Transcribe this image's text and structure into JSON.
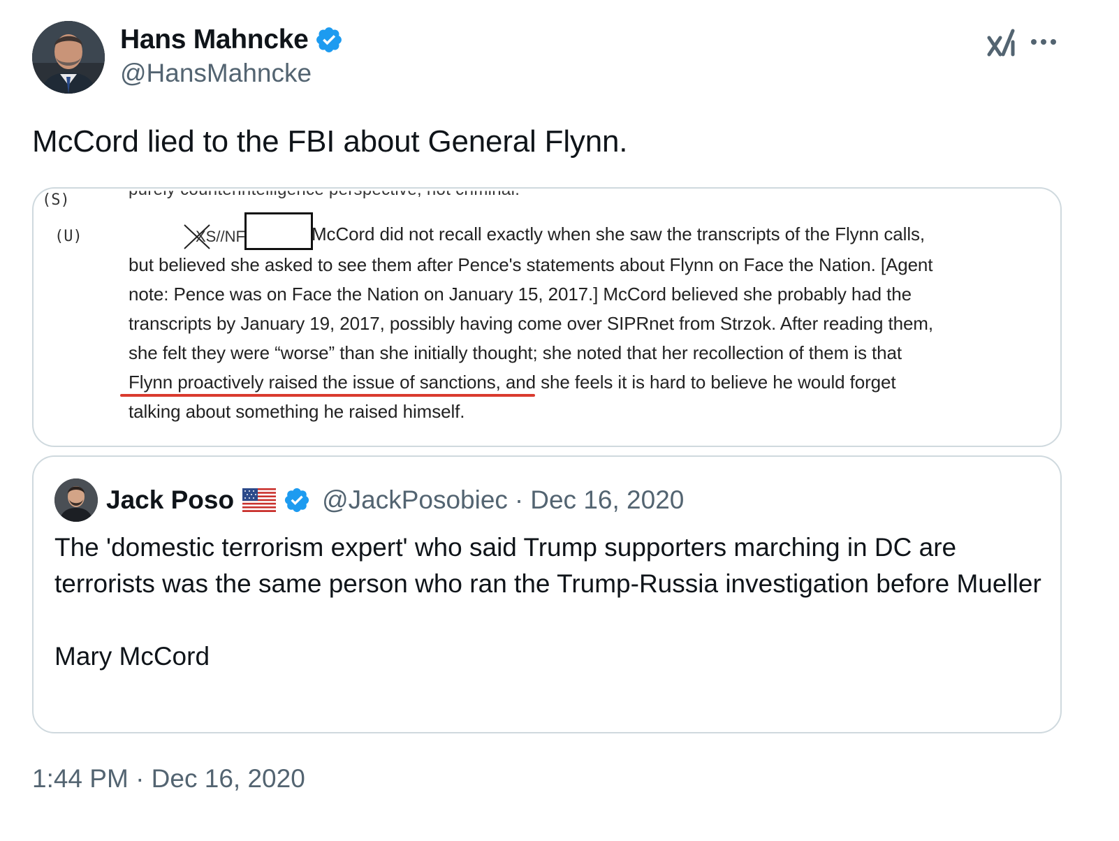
{
  "author": {
    "display_name": "Hans Mahncke",
    "handle": "@HansMahncke",
    "verified": true,
    "avatar": "author-avatar-photo"
  },
  "header_icons": {
    "grok": "grok-icon",
    "more": "more-icon"
  },
  "tweet": {
    "text": "McCord lied to the FBI about General Flynn."
  },
  "media": {
    "marker_s": "(S)",
    "marker_u": "(U)",
    "redaction_mark": "XS//NF",
    "lines": [
      "McCord did not recall exactly when she saw the transcripts of the Flynn calls,",
      "but believed she asked to see them after Pence's statements about Flynn on Face the Nation. [Agent",
      "note: Pence was on Face the Nation on January 15, 2017.] McCord believed she probably had the",
      "transcripts by January 19, 2017, possibly having come over SIPRnet from Strzok. After reading them,",
      "she felt they were “worse” than she initially thought; she noted that her recollection of them is that",
      "Flynn proactively raised the issue of sanctions, and she feels it is hard to believe he would forget",
      "talking about something he raised himself."
    ],
    "cut_line": "purely counterintelligence perspective, not criminal.",
    "underline_color": "#d93a2e"
  },
  "quote": {
    "display_name": "Jack Poso",
    "flag": "us-flag-icon",
    "verified": true,
    "handle": "@JackPosobiec",
    "separator": "·",
    "date": "Dec 16, 2020",
    "paragraph1": "The 'domestic terrorism expert' who said Trump supporters marching in DC are terrorists was the same person who ran the Trump-Russia investigation before Mueller",
    "paragraph2": "Mary McCord"
  },
  "timestamp": "1:44 PM · Dec 16, 2020",
  "colors": {
    "verified_blue": "#1d9bf0",
    "secondary_text": "#536471",
    "border": "#cfd9de"
  }
}
